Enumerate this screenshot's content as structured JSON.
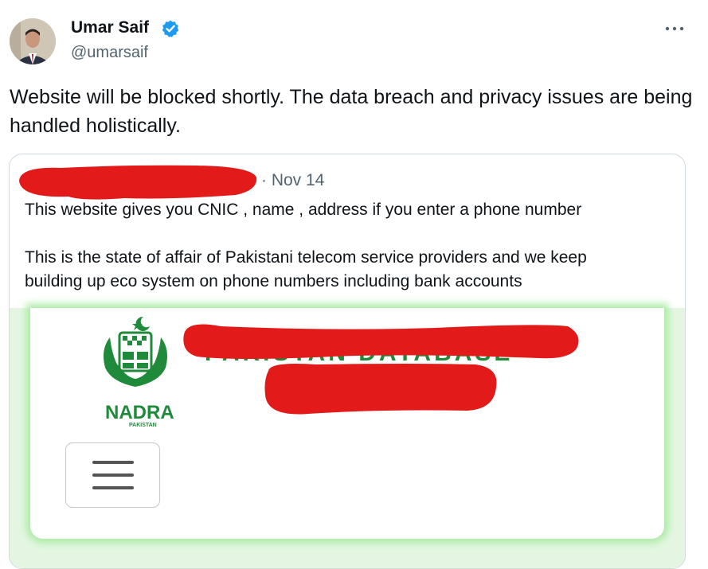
{
  "author": {
    "name": "Umar Saif",
    "handle": "@umarsaif",
    "avatar_icon": "profile-photo",
    "verified_color": "#1d9bf0"
  },
  "more_icon": "more-horizontal-icon",
  "tweet": {
    "text": "Website will be blocked shortly. The data breach and privacy issues are being handled holistically."
  },
  "quote": {
    "date": "· Nov 14",
    "line1": "This website gives you CNIC , name , address if you enter a phone number",
    "line2": "This is the state of affair of Pakistani telecom service providers and we keep",
    "line3": "building up eco system on phone numbers including bank accounts",
    "media": {
      "logo_text": "NADRA",
      "logo_subtext": "PAKISTAN",
      "menu_icon": "hamburger-menu-icon",
      "accent": "#1f8a3a",
      "redaction_color": "#e31a1a"
    }
  }
}
